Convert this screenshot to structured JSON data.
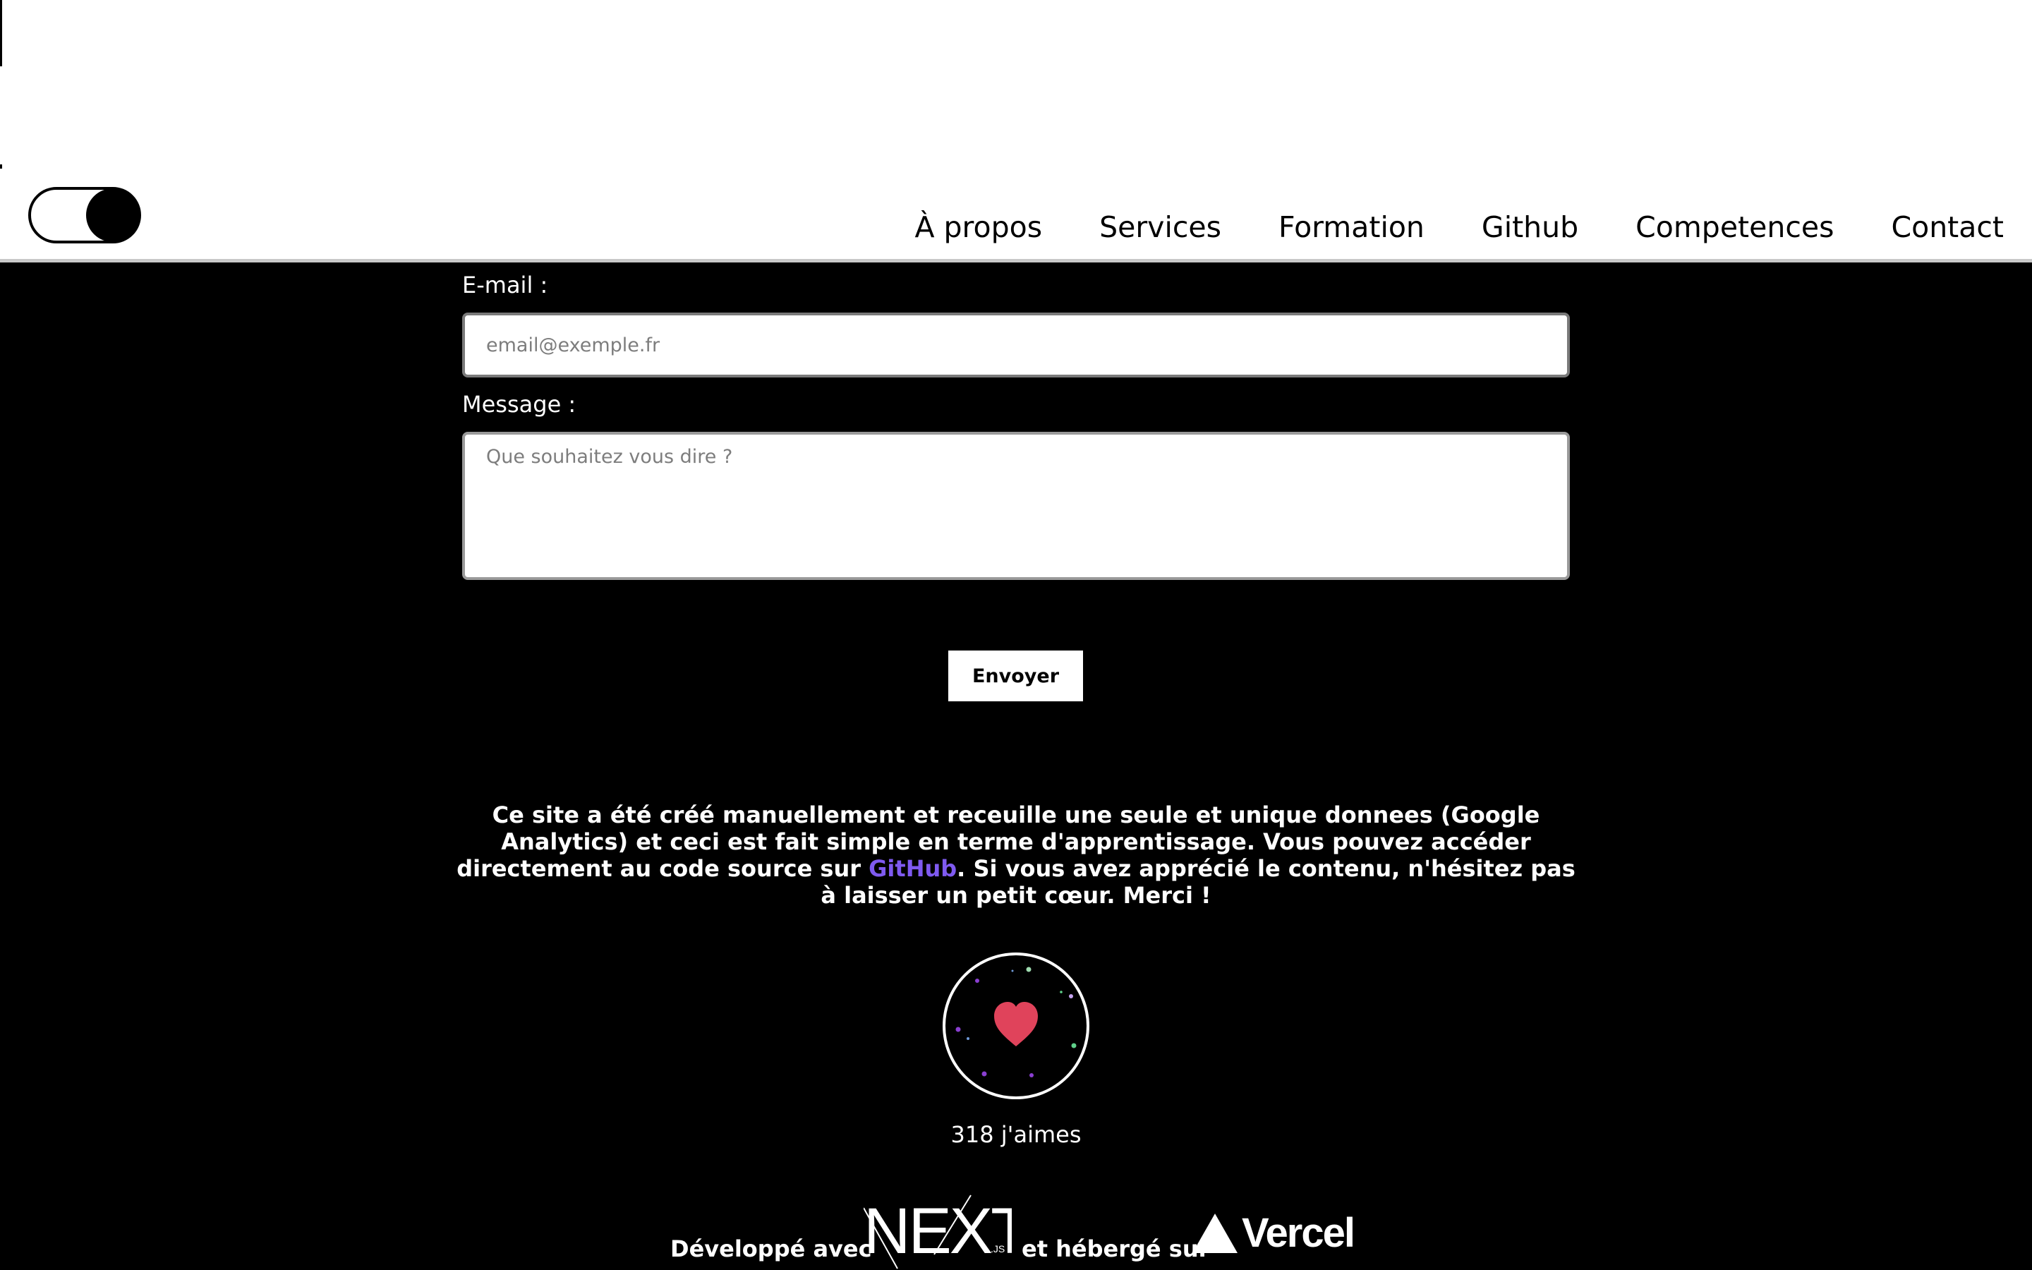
{
  "nav": {
    "items": [
      "À propos",
      "Services",
      "Formation",
      "Github",
      "Competences",
      "Contact"
    ]
  },
  "form": {
    "email_label": "E-mail :",
    "email_placeholder": "email@exemple.fr",
    "message_label": "Message :",
    "message_placeholder": "Que souhaitez vous dire ?",
    "submit_label": "Envoyer"
  },
  "note": {
    "part1": "Ce site a été créé manuellement et receuille une seule et unique donnees (Google Analytics) et ceci est fait simple en terme d'apprentissage. Vous pouvez accéder directement au code source sur ",
    "link": "GitHub",
    "part2": ". Si vous avez apprécié le contenu, n'hésitez pas à laisser un petit cœur. Merci !"
  },
  "likes": {
    "count_label": "318 j'aimes"
  },
  "credits": {
    "dev_prefix": "Développé avec",
    "host_prefix": "et hébergé sur",
    "next_logo_text": "NEXT",
    "next_logo_suffix": ".JS",
    "vercel_name": "Vercel"
  },
  "colors": {
    "accent_link": "#7f5af0",
    "heart": "#e0435b",
    "background": "#000000",
    "header_bg": "#ffffff"
  },
  "icons": [
    "toggle-switch",
    "heart-icon",
    "nextjs-logo",
    "vercel-triangle-icon"
  ]
}
